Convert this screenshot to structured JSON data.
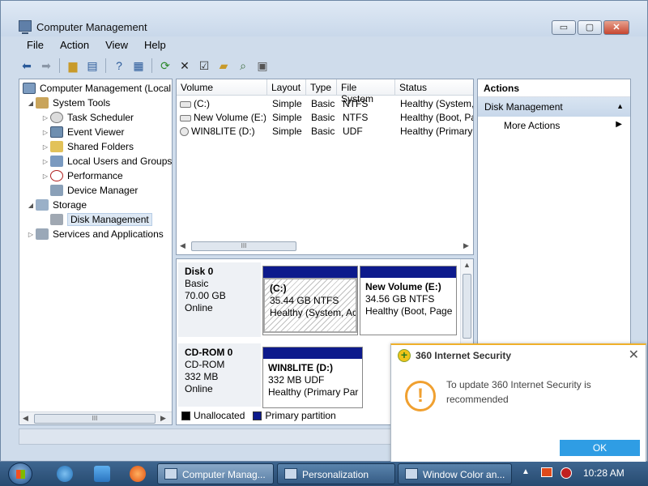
{
  "window": {
    "title": "Computer Management",
    "buttons": [
      "▭",
      "▢",
      "✕"
    ]
  },
  "menu": [
    "File",
    "Action",
    "View",
    "Help"
  ],
  "toolbar": {
    "icons": [
      "back-arrow-icon",
      "forward-arrow-icon",
      "up-folder-icon",
      "show-hide-tree-icon",
      "help-icon",
      "properties-view-icon",
      "refresh-icon",
      "delete-icon",
      "properties-icon",
      "open-icon",
      "search-icon",
      "export-icon"
    ]
  },
  "tree": {
    "items": [
      {
        "label": "Computer Management (Local",
        "level": 0,
        "expander": ""
      },
      {
        "label": "System Tools",
        "level": 1,
        "expander": "◢"
      },
      {
        "label": "Task Scheduler",
        "level": 2,
        "expander": "▷"
      },
      {
        "label": "Event Viewer",
        "level": 2,
        "expander": "▷"
      },
      {
        "label": "Shared Folders",
        "level": 2,
        "expander": "▷"
      },
      {
        "label": "Local Users and Groups",
        "level": 2,
        "expander": "▷"
      },
      {
        "label": "Performance",
        "level": 2,
        "expander": "▷"
      },
      {
        "label": "Device Manager",
        "level": 2,
        "expander": ""
      },
      {
        "label": "Storage",
        "level": 1,
        "expander": "◢"
      },
      {
        "label": "Disk Management",
        "level": 2,
        "expander": "",
        "selected": true
      },
      {
        "label": "Services and Applications",
        "level": 1,
        "expander": "▷"
      }
    ],
    "scroll_grip": "III"
  },
  "volumes": {
    "columns": [
      "Volume",
      "Layout",
      "Type",
      "File System",
      "Status"
    ],
    "rows": [
      [
        "(C:)",
        "Simple",
        "Basic",
        "NTFS",
        "Healthy (System,"
      ],
      [
        "New Volume (E:)",
        "Simple",
        "Basic",
        "NTFS",
        "Healthy (Boot, Pa"
      ],
      [
        "WIN8LITE (D:)",
        "Simple",
        "Basic",
        "UDF",
        "Healthy (Primary"
      ]
    ],
    "scroll_grip": "III"
  },
  "disks": [
    {
      "name": "Disk 0",
      "type": "Basic",
      "size": "70.00 GB",
      "state": "Online",
      "partitions": [
        {
          "name": "(C:)",
          "size": "35.44 GB NTFS",
          "status": "Healthy (System, Ac"
        },
        {
          "name": "New Volume  (E:)",
          "size": "34.56 GB NTFS",
          "status": "Healthy (Boot, Page"
        }
      ]
    },
    {
      "name": "CD-ROM 0",
      "type": "CD-ROM",
      "size": "332 MB",
      "state": "Online",
      "partitions": [
        {
          "name": "WIN8LITE  (D:)",
          "size": "332 MB UDF",
          "status": "Healthy (Primary Par"
        }
      ]
    }
  ],
  "legend": {
    "unallocated": "Unallocated",
    "primary": "Primary partition",
    "unallocated_color": "#000000",
    "primary_color": "#0d1a8c"
  },
  "actions": {
    "header": "Actions",
    "section": "Disk Management",
    "item": "More Actions"
  },
  "popup": {
    "title": "360 Internet Security",
    "message": "To update 360 Internet Security is recommended",
    "ok": "OK",
    "accent_color": "#2f9de4"
  },
  "taskbar": {
    "tasks": [
      "Computer Manag...",
      "Personalization",
      "Window Color an..."
    ],
    "clock": "10:28 AM"
  }
}
